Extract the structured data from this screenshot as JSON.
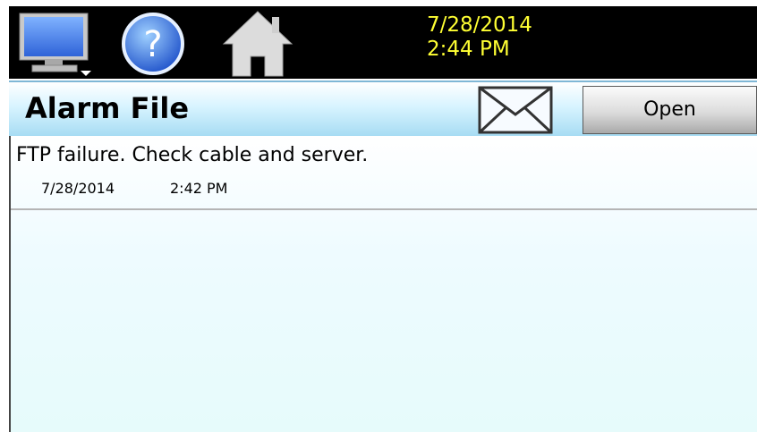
{
  "topbar": {
    "date": "7/28/2014",
    "time": "2:44 PM",
    "icons": [
      "monitor-icon",
      "help-icon",
      "home-icon"
    ],
    "datetime_color": "#ffff33"
  },
  "header": {
    "title": "Alarm File",
    "mail_icon": "envelope-icon",
    "open_label": "Open"
  },
  "alarms": [
    {
      "message": "FTP failure. Check cable and server.",
      "date": "7/28/2014",
      "time": "2:42 PM"
    }
  ]
}
